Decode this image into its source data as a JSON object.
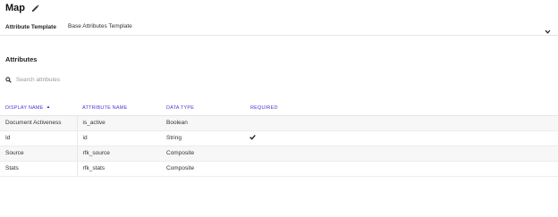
{
  "header": {
    "title": "Map",
    "edit_icon": "pencil-icon"
  },
  "template": {
    "label": "Attribute Template",
    "selected": "Base Attributes Template",
    "chevron_icon": "chevron-down-icon"
  },
  "attributes": {
    "title": "Attributes",
    "search": {
      "icon": "search-icon",
      "placeholder": "Search attributes"
    },
    "columns": {
      "display_name": "DISPLAY NAME",
      "attribute_name": "ATTRIBUTE NAME",
      "data_type": "DATA TYPE",
      "required": "REQUIRED"
    },
    "sort_indicator": "▲",
    "rows": [
      {
        "display_name": "Document Activeness",
        "attribute_name": "is_active",
        "data_type": "Boolean",
        "required": false
      },
      {
        "display_name": "Id",
        "attribute_name": "id",
        "data_type": "String",
        "required": true
      },
      {
        "display_name": "Source",
        "attribute_name": "rfk_source",
        "data_type": "Composite",
        "required": false
      },
      {
        "display_name": "Stats",
        "attribute_name": "rfk_stats",
        "data_type": "Composite",
        "required": false
      }
    ]
  },
  "colors": {
    "accent": "#4b3bd0",
    "row_alt": "#f7f7f7",
    "border": "#e6e6e6"
  }
}
